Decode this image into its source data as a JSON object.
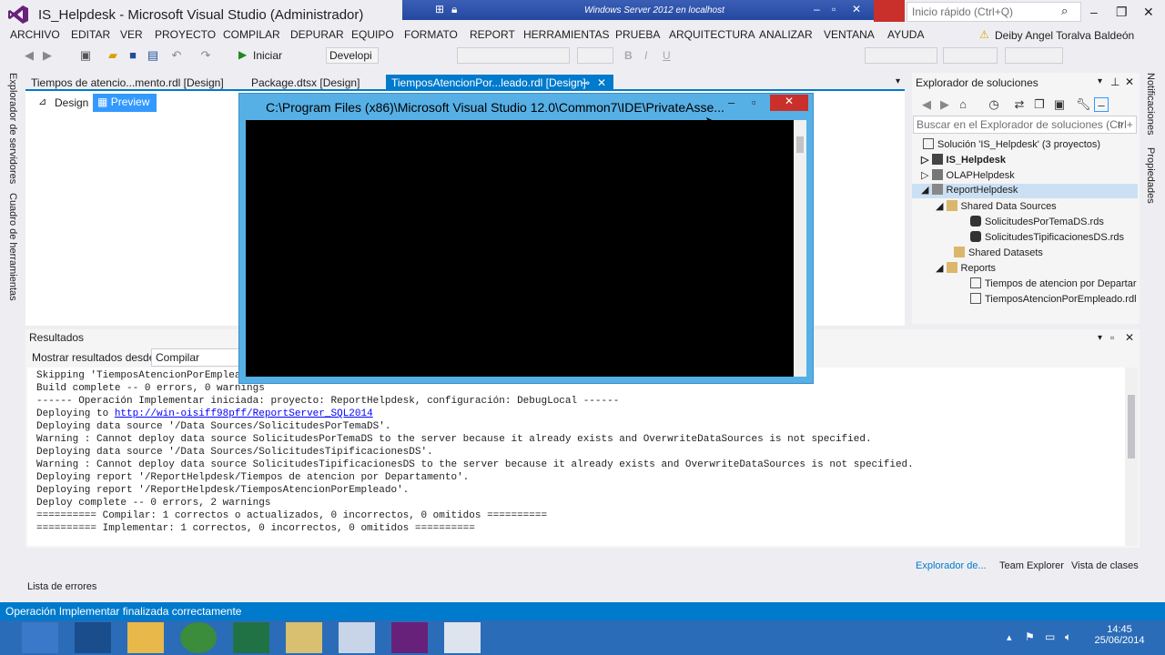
{
  "app": {
    "title": "IS_Helpdesk - Microsoft Visual Studio (Administrador)"
  },
  "rdp": {
    "title": "Windows Server 2012 en localhost"
  },
  "quick_launch": {
    "placeholder": "Inicio rápido (Ctrl+Q)"
  },
  "menu": {
    "items": [
      "ARCHIVO",
      "EDITAR",
      "VER",
      "PROYECTO",
      "COMPILAR",
      "DEPURAR",
      "EQUIPO",
      "FORMATO",
      "REPORT",
      "HERRAMIENTAS",
      "PRUEBA",
      "ARQUITECTURA",
      "ANALIZAR",
      "VENTANA",
      "AYUDA"
    ],
    "user": "Deiby Angel Toralva Baldeón"
  },
  "toolbar": {
    "run_label": "Iniciar",
    "config": "Developi"
  },
  "left_tabs": {
    "server_explorer": "Explorador de servidores",
    "toolbox": "Cuadro de herramientas"
  },
  "doc_tabs": [
    {
      "label": "Tiempos de atencio...mento.rdl [Design]"
    },
    {
      "label": "Package.dtsx [Design]"
    },
    {
      "label": "TiemposAtencionPor...leado.rdl [Design]"
    }
  ],
  "design": {
    "design_tab": "Design",
    "preview_tab": "Preview"
  },
  "console": {
    "title": "C:\\Program Files (x86)\\Microsoft Visual Studio 12.0\\Common7\\IDE\\PrivateAsse..."
  },
  "solution_explorer": {
    "header": "Explorador de soluciones",
    "search": "Buscar en el Explorador de soluciones (Ctrl+",
    "tree": [
      "Solución 'IS_Helpdesk' (3 proyectos)",
      "IS_Helpdesk",
      "OLAPHelpdesk",
      "ReportHelpdesk",
      "Shared Data Sources",
      "SolicitudesPorTemaDS.rds",
      "SolicitudesTipificacionesDS.rds",
      "Shared Datasets",
      "Reports",
      "Tiempos de atencion por Departar",
      "TiemposAtencionPorEmpleado.rdl"
    ]
  },
  "right_tabs": {
    "notifications": "Notificaciones",
    "properties": "Propiedades"
  },
  "output": {
    "header": "Resultados",
    "show_label": "Mostrar resultados desde:",
    "source": "Compilar",
    "lines": [
      "Skipping 'TiemposAtencionPorEmplea",
      "Build complete -- 0 errors, 0 warnings",
      "------ Operación Implementar iniciada: proyecto: ReportHelpdesk, configuración: DebugLocal ------",
      "Deploying to ",
      "Deploying data source '/Data Sources/SolicitudesPorTemaDS'.",
      "Warning : Cannot deploy data source SolicitudesPorTemaDS to the server because it already exists and OverwriteDataSources is not specified.",
      "Deploying data source '/Data Sources/SolicitudesTipificacionesDS'.",
      "Warning : Cannot deploy data source SolicitudesTipificacionesDS to the server because it already exists and OverwriteDataSources is not specified.",
      "Deploying report '/ReportHelpdesk/Tiempos de atencion por Departamento'.",
      "Deploying report '/ReportHelpdesk/TiemposAtencionPorEmpleado'.",
      "Deploy complete -- 0 errors, 2 warnings",
      "========== Compilar: 1 correctos o actualizados, 0 incorrectos, 0 omitidos ==========",
      "========== Implementar: 1 correctos, 0 incorrectos, 0 omitidos =========="
    ],
    "url": "http://win-oisiff98pff/ReportServer_SQL2014"
  },
  "bottom_tabs": {
    "error_list": "Lista de errores",
    "sol_exp": "Explorador de...",
    "team": "Team Explorer",
    "classes": "Vista de clases"
  },
  "status": {
    "text": "Operación Implementar finalizada correctamente"
  },
  "clock": {
    "time": "14:45",
    "date": "25/06/2014"
  },
  "colors": {
    "accent": "#007acc",
    "taskbar": "#2b6cb8",
    "close": "#c9302c",
    "vs_purple": "#68217a"
  }
}
